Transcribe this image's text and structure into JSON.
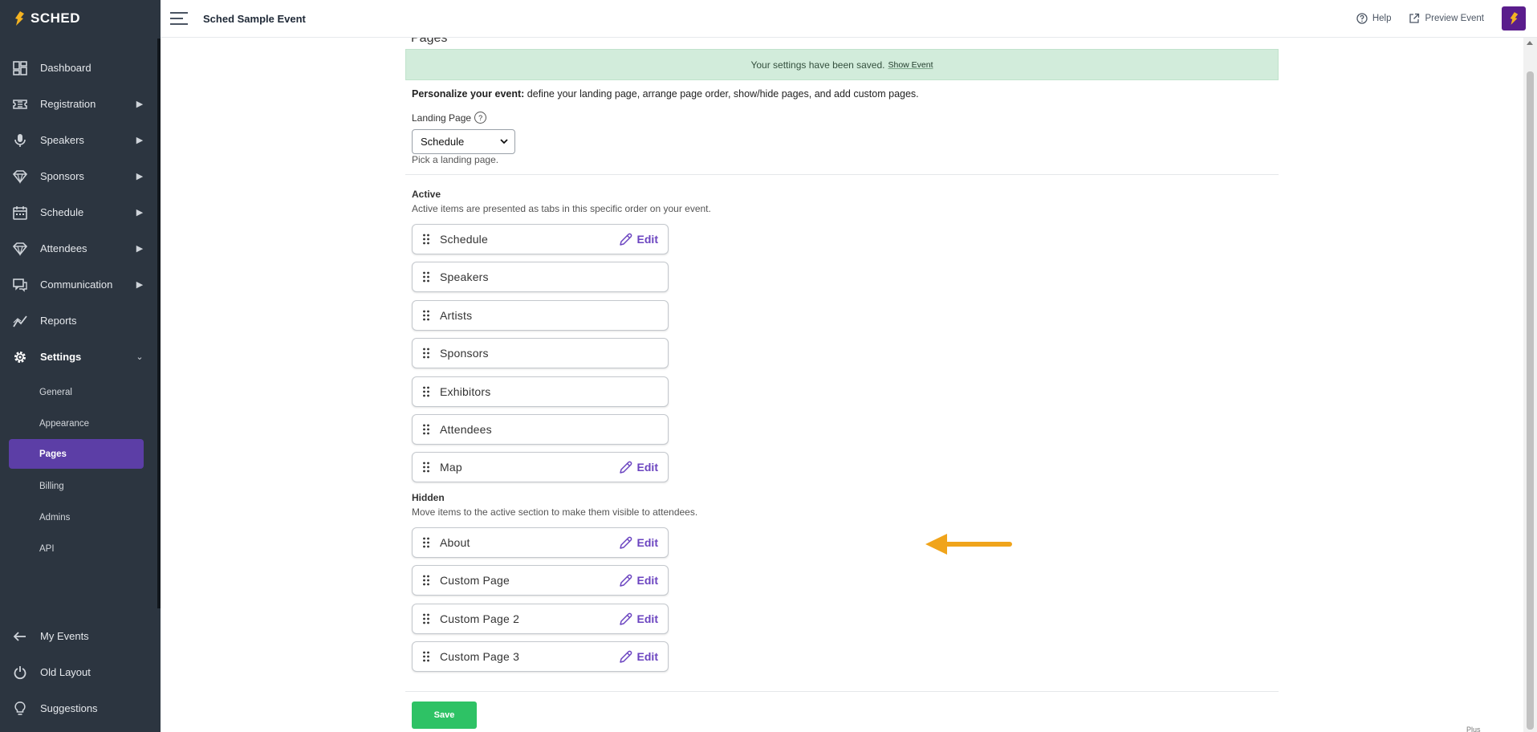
{
  "brand": {
    "name": "SCHED"
  },
  "sidebar": {
    "items": [
      {
        "label": "Dashboard",
        "icon": "dashboard-icon",
        "chevron": false
      },
      {
        "label": "Registration",
        "icon": "ticket-icon",
        "chevron": true
      },
      {
        "label": "Speakers",
        "icon": "microphone-icon",
        "chevron": true
      },
      {
        "label": "Sponsors",
        "icon": "diamond-icon",
        "chevron": true
      },
      {
        "label": "Schedule",
        "icon": "calendar-icon",
        "chevron": true
      },
      {
        "label": "Attendees",
        "icon": "diamond-icon",
        "chevron": true
      },
      {
        "label": "Communication",
        "icon": "chat-icon",
        "chevron": true
      },
      {
        "label": "Reports",
        "icon": "chart-icon",
        "chevron": false
      },
      {
        "label": "Settings",
        "icon": "gear-icon",
        "chevron": true,
        "expanded": true
      }
    ],
    "settings_sub": [
      "General",
      "Appearance",
      "Pages",
      "Billing",
      "Admins",
      "API"
    ],
    "active_sub": "Pages",
    "bottom": [
      {
        "label": "My Events",
        "icon": "arrow-left-icon"
      },
      {
        "label": "Old Layout",
        "icon": "power-icon"
      },
      {
        "label": "Suggestions",
        "icon": "lightbulb-icon"
      }
    ]
  },
  "header": {
    "event_title": "Sched Sample Event",
    "help_label": "Help",
    "preview_label": "Preview Event"
  },
  "main": {
    "heading": "Pages",
    "alert": {
      "text": "Your settings have been saved.",
      "link": "Show Event"
    },
    "intro_bold": "Personalize your event:",
    "intro_text": " define your landing page, arrange page order, show/hide pages, and add custom pages.",
    "landing_page": {
      "label": "Landing Page",
      "help": "?",
      "value": "Schedule",
      "hint": "Pick a landing page."
    },
    "active": {
      "title": "Active",
      "desc": "Active items are presented as tabs in this specific order on your event.",
      "items": [
        {
          "name": "Schedule",
          "editable": true
        },
        {
          "name": "Speakers",
          "editable": false
        },
        {
          "name": "Artists",
          "editable": false
        },
        {
          "name": "Sponsors",
          "editable": false
        },
        {
          "name": "Exhibitors",
          "editable": false
        },
        {
          "name": "Attendees",
          "editable": false
        },
        {
          "name": "Map",
          "editable": true
        }
      ]
    },
    "hidden": {
      "title": "Hidden",
      "desc": "Move items to the active section to make them visible to attendees.",
      "items": [
        {
          "name": "About",
          "editable": true
        },
        {
          "name": "Custom Page",
          "editable": true
        },
        {
          "name": "Custom Page 2",
          "editable": true
        },
        {
          "name": "Custom Page 3",
          "editable": true
        }
      ]
    },
    "edit_label": "Edit",
    "save_label": "Save",
    "plan_label": "Plus"
  },
  "colors": {
    "sidebar_bg": "#2c3540",
    "accent": "#5c3ea6",
    "edit_purple": "#6b44c0",
    "success_bg": "#d2ecdb",
    "save_green": "#2ec265",
    "arrow_orange": "#f0a41b"
  }
}
